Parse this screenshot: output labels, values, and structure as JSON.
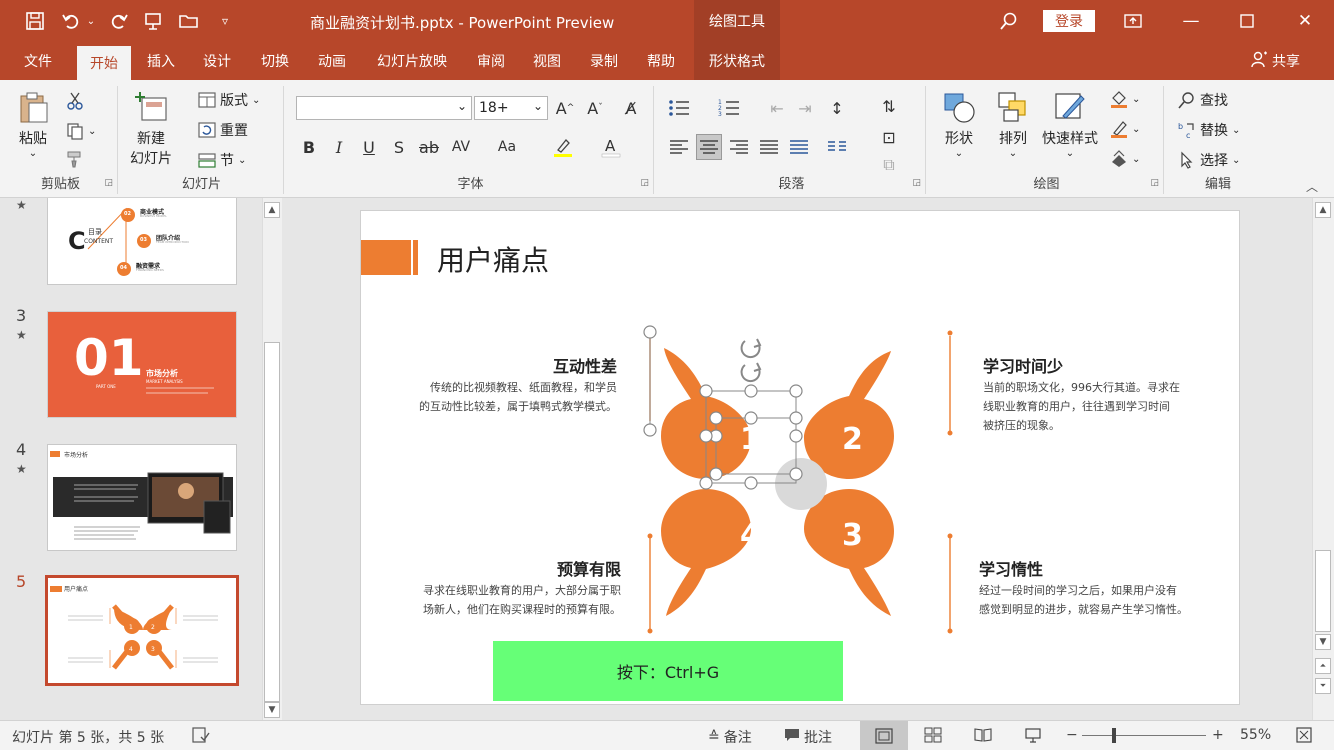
{
  "titlebar": {
    "document_title": "商业融资计划书.pptx - PowerPoint Preview",
    "context_tab_title": "绘图工具",
    "login_label": "登录",
    "quick_access_icons": [
      "save-icon",
      "undo-icon",
      "redo-icon",
      "present-icon",
      "open-folder-icon",
      "customize-icon"
    ]
  },
  "tabs": [
    {
      "label": "文件"
    },
    {
      "label": "开始"
    },
    {
      "label": "插入"
    },
    {
      "label": "设计"
    },
    {
      "label": "切换"
    },
    {
      "label": "动画"
    },
    {
      "label": "幻灯片放映"
    },
    {
      "label": "审阅"
    },
    {
      "label": "视图"
    },
    {
      "label": "录制"
    },
    {
      "label": "帮助"
    },
    {
      "label": "形状格式"
    }
  ],
  "share_label": "共享",
  "ribbon": {
    "clipboard": {
      "label": "剪贴板",
      "paste": "粘贴"
    },
    "slides": {
      "label": "幻灯片",
      "new_slide_line1": "新建",
      "new_slide_line2": "幻灯片",
      "layout": "版式",
      "reset": "重置",
      "section": "节"
    },
    "font": {
      "label": "字体",
      "font_name": "",
      "font_size": "18+"
    },
    "paragraph": {
      "label": "段落"
    },
    "drawing": {
      "label": "绘图",
      "shapes": "形状",
      "arrange": "排列",
      "quick_styles": "快速样式"
    },
    "editing": {
      "label": "编辑",
      "find": "查找",
      "replace": "替换",
      "select": "选择"
    }
  },
  "thumbnails": [
    {
      "num": "",
      "title": "目录",
      "subtitle": "CONTENT",
      "items": [
        "02",
        "03",
        "04"
      ],
      "labels": [
        "商业模式",
        "团队介绍",
        "融资需求"
      ],
      "en": [
        "BUSINESS MODEL",
        "TEAM INTRODUCTION",
        "FINANCING NEEDS"
      ]
    },
    {
      "num": "3",
      "big": "01",
      "title": "市场分析",
      "subtitle": "MARKET ANALYSIS",
      "part": "PART ONE"
    },
    {
      "num": "4",
      "title": "市场分析"
    },
    {
      "num": "5",
      "title": "用户痛点"
    }
  ],
  "slide": {
    "title": "用户痛点",
    "accent_color": "#ed7d31",
    "petals": [
      "1",
      "2",
      "3",
      "4"
    ],
    "blocks": [
      {
        "heading": "互动性差",
        "line1": "传统的比视频教程、纸面教程，和学员",
        "line2": "的互动性比较差，属于填鸭式教学模式。"
      },
      {
        "heading": "学习时间少",
        "line1": "当前的职场文化，996大行其道。寻求在",
        "line2": "线职业教育的用户，往往遇到学习时间",
        "line3": "被挤压的现象。"
      },
      {
        "heading": "预算有限",
        "line1": "寻求在线职业教育的用户，大部分属于职",
        "line2": "场新人，他们在购买课程时的预算有限。"
      },
      {
        "heading": "学习惰性",
        "line1": "经过一段时间的学习之后，如果用户没有",
        "line2": "感觉到明显的进步，就容易产生学习惰性。"
      }
    ],
    "hint": "按下：Ctrl+G"
  },
  "statusbar": {
    "slide_info": "幻灯片 第 5 张，共 5 张",
    "notes": "备注",
    "comments": "批注",
    "zoom": "55%",
    "zoom_level": 0.55
  }
}
